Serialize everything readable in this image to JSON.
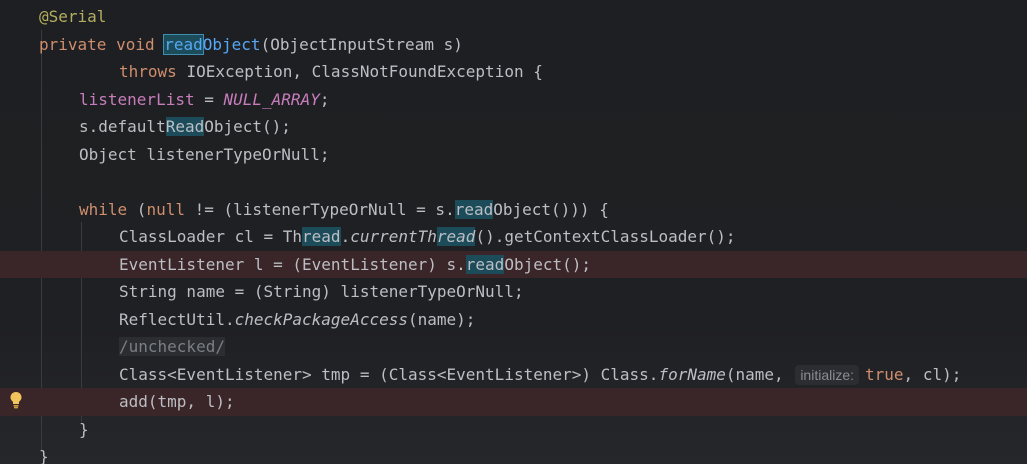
{
  "lines": [
    {
      "id": "l1",
      "tokens": [
        {
          "t": "@Serial",
          "c": "ann"
        }
      ]
    },
    {
      "id": "l2",
      "tokens": [
        {
          "t": "private ",
          "c": "kw"
        },
        {
          "t": "void ",
          "c": "kw"
        },
        {
          "t": "read",
          "c": "fn mark box"
        },
        {
          "t": "Object",
          "c": "fn"
        },
        {
          "t": "(ObjectInputStream s)"
        }
      ]
    },
    {
      "id": "l3",
      "tokens": [
        {
          "t": "throws ",
          "c": "kw"
        },
        {
          "t": "IOException, ClassNotFoundException {"
        }
      ]
    },
    {
      "id": "l4",
      "tokens": [
        {
          "t": "listenerList",
          "c": "field"
        },
        {
          "t": " = "
        },
        {
          "t": "NULL_ARRAY",
          "c": "cnst"
        },
        {
          "t": ";"
        }
      ]
    },
    {
      "id": "l5",
      "tokens": [
        {
          "t": "s.default"
        },
        {
          "t": "Read",
          "c": "mark"
        },
        {
          "t": "Object();"
        }
      ]
    },
    {
      "id": "l6",
      "tokens": [
        {
          "t": "Object listenerTypeOrNull;"
        }
      ]
    },
    {
      "id": "l7",
      "tokens": []
    },
    {
      "id": "l8",
      "tokens": [
        {
          "t": "while ",
          "c": "kw"
        },
        {
          "t": "("
        },
        {
          "t": "null ",
          "c": "kw"
        },
        {
          "t": "!= (listenerTypeOrNull = s."
        },
        {
          "t": "read",
          "c": "mark"
        },
        {
          "t": "Object())) {"
        }
      ]
    },
    {
      "id": "l9",
      "tokens": [
        {
          "t": "ClassLoader cl = Th"
        },
        {
          "t": "read",
          "c": "mark"
        },
        {
          "t": "."
        },
        {
          "t": "currentTh",
          "c": "ital"
        },
        {
          "t": "read",
          "c": "ital mark"
        },
        {
          "t": "().getContextClassLoader();"
        }
      ]
    },
    {
      "id": "l10",
      "tokens": [
        {
          "t": "EventListener l = (EventListener) s."
        },
        {
          "t": "read",
          "c": "mark"
        },
        {
          "t": "Object();"
        }
      ]
    },
    {
      "id": "l11",
      "tokens": [
        {
          "t": "String name = (String) listenerTypeOrNull;"
        }
      ]
    },
    {
      "id": "l12",
      "tokens": [
        {
          "t": "ReflectUtil."
        },
        {
          "t": "checkPackageAccess",
          "c": "ital"
        },
        {
          "t": "(name);"
        }
      ]
    },
    {
      "id": "l13",
      "tokens": [
        {
          "t": "/unchecked/",
          "c": "comment"
        }
      ]
    },
    {
      "id": "l14",
      "tokens": [
        {
          "t": "Class<EventListener> tmp = (Class<EventListener>) Class."
        },
        {
          "t": "forName",
          "c": "ital"
        },
        {
          "t": "(name, "
        },
        {
          "t": "initialize:",
          "c": "hint"
        },
        {
          "t": "true",
          "c": "kw"
        },
        {
          "t": ", cl);"
        }
      ]
    },
    {
      "id": "l15",
      "tokens": [
        {
          "t": "add(tmp, l);"
        }
      ]
    },
    {
      "id": "l16",
      "tokens": [
        {
          "t": "}"
        }
      ]
    },
    {
      "id": "l17",
      "tokens": [
        {
          "t": "}"
        }
      ]
    }
  ],
  "colors": {
    "background": "#1e1f22",
    "highlight": "#3a2528",
    "keyword": "#cf8e6d",
    "annotation": "#b3ae60",
    "method": "#56a8f5",
    "field": "#c77dbb",
    "search_match": "#1c4c5a"
  },
  "gutter_icon": "lightbulb-icon"
}
